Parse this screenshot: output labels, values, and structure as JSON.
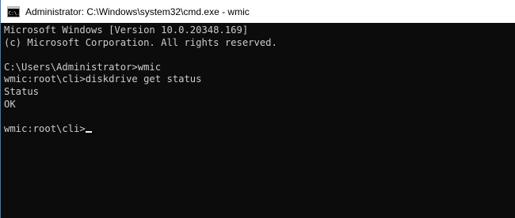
{
  "window": {
    "title": "Administrator: C:\\Windows\\system32\\cmd.exe - wmic",
    "icon": "cmd-icon",
    "icon_label": "C:\\."
  },
  "console": {
    "lines": [
      "Microsoft Windows [Version 10.0.20348.169]",
      "(c) Microsoft Corporation. All rights reserved.",
      "",
      "C:\\Users\\Administrator>wmic",
      "wmic:root\\cli>diskdrive get status",
      "Status",
      "OK",
      "",
      "wmic:root\\cli>"
    ],
    "prompt_input": ""
  },
  "colors": {
    "console_bg": "#0c0c0c",
    "console_text": "#cccccc",
    "titlebar_bg": "#ffffff",
    "window_border": "#2b7cd3"
  }
}
